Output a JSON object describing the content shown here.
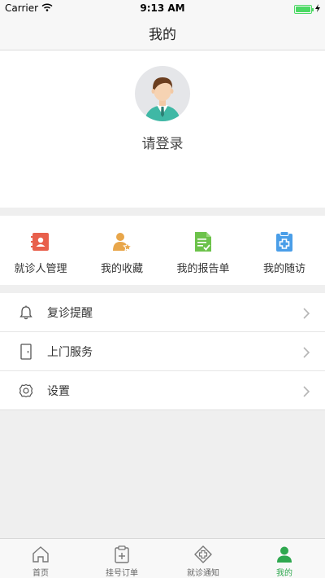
{
  "status_bar": {
    "carrier": "Carrier",
    "time": "9:13 AM"
  },
  "nav": {
    "title": "我的"
  },
  "profile": {
    "login_label": "请登录"
  },
  "quick_actions": [
    {
      "label": "就诊人管理",
      "icon": "patient-card-icon",
      "color": "#e8604c"
    },
    {
      "label": "我的收藏",
      "icon": "favorite-person-icon",
      "color": "#e8a64a"
    },
    {
      "label": "我的报告单",
      "icon": "report-icon",
      "color": "#6cc24a"
    },
    {
      "label": "我的随访",
      "icon": "followup-clipboard-icon",
      "color": "#4a9ee8"
    }
  ],
  "menu": [
    {
      "label": "复诊提醒",
      "icon": "bell-icon"
    },
    {
      "label": "上门服务",
      "icon": "door-icon"
    },
    {
      "label": "设置",
      "icon": "gear-icon"
    }
  ],
  "tabbar": {
    "items": [
      {
        "label": "首页",
        "icon": "home-icon"
      },
      {
        "label": "挂号订单",
        "icon": "clipboard-plus-icon"
      },
      {
        "label": "就诊通知",
        "icon": "diamond-plus-icon"
      },
      {
        "label": "我的",
        "icon": "person-icon"
      }
    ],
    "active_index": 3,
    "active_color": "#2fa84f"
  }
}
